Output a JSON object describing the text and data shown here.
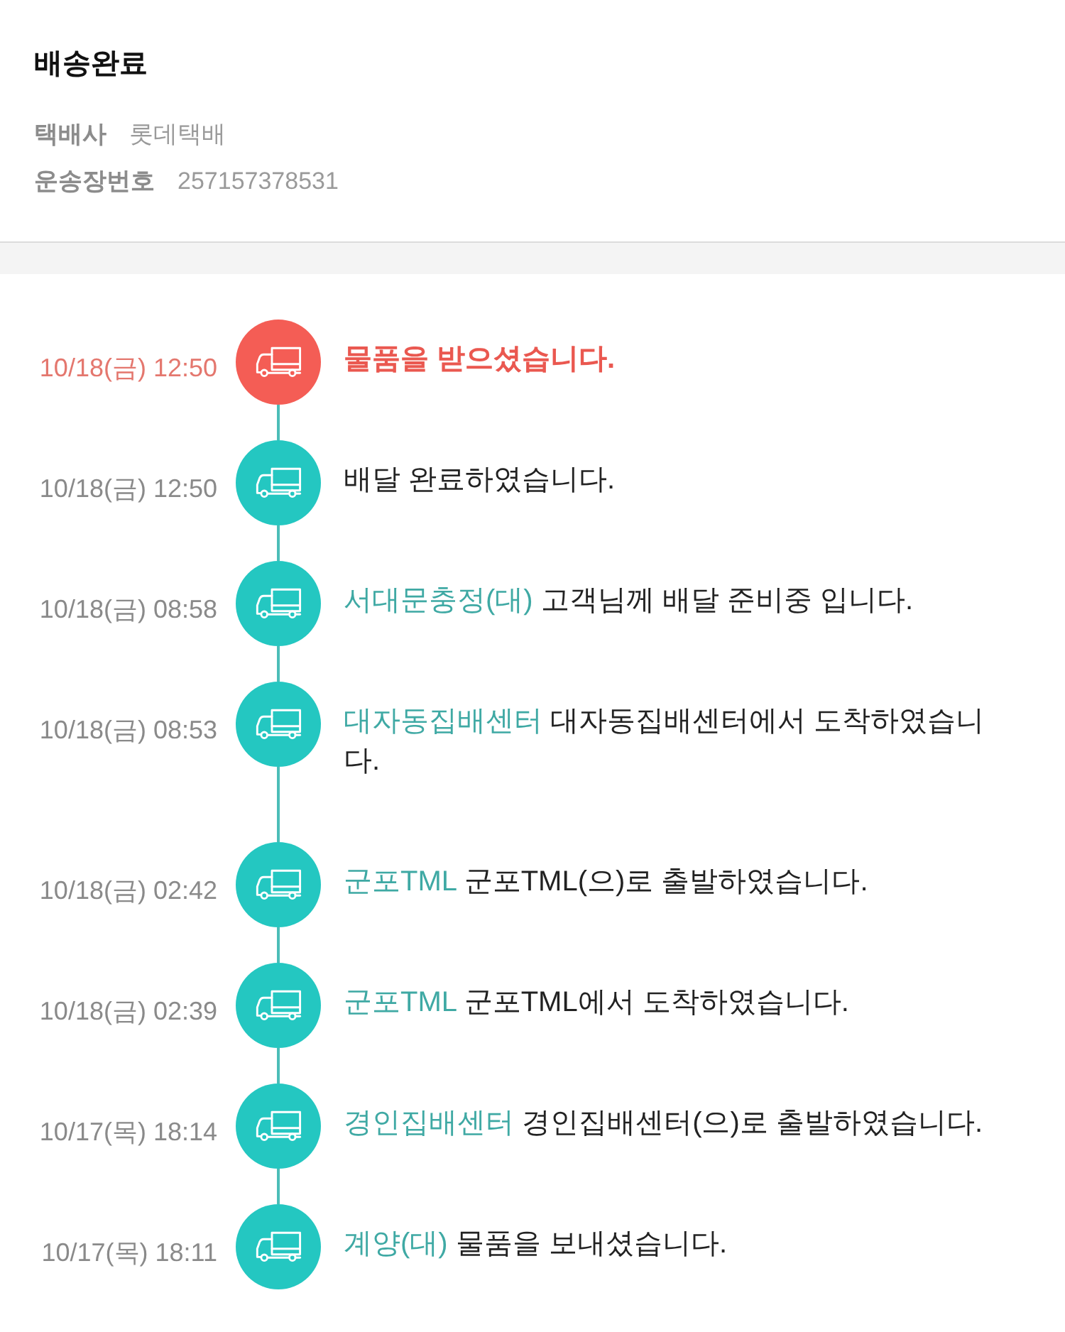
{
  "header": {
    "title": "배송완료",
    "details": [
      {
        "label": "택배사",
        "value": "롯데택배"
      },
      {
        "label": "운송장번호",
        "value": "257157378531"
      }
    ]
  },
  "timeline": [
    {
      "time": "10/18(금) 12:50",
      "message": "물품을 받으셨습니다.",
      "current": true
    },
    {
      "time": "10/18(금) 12:50",
      "message": "배달 완료하였습니다.",
      "current": false
    },
    {
      "time": "10/18(금) 08:58",
      "place": "서대문충정(대)",
      "message": "고객님께 배달 준비중 입니다.",
      "current": false
    },
    {
      "time": "10/18(금) 08:53",
      "place": "대자동집배센터",
      "message": "대자동집배센터에서 도착하였습니다.",
      "current": false
    },
    {
      "time": "10/18(금) 02:42",
      "place": "군포TML",
      "message": "군포TML(으)로 출발하였습니다.",
      "current": false
    },
    {
      "time": "10/18(금) 02:39",
      "place": "군포TML",
      "message": "군포TML에서 도착하였습니다.",
      "current": false
    },
    {
      "time": "10/17(목) 18:14",
      "place": "경인집배센터",
      "message": "경인집배센터(으)로 출발하였습니다.",
      "current": false
    },
    {
      "time": "10/17(목) 18:11",
      "place": "계양(대)",
      "message": "물품을 보내셨습니다.",
      "current": false
    }
  ]
}
